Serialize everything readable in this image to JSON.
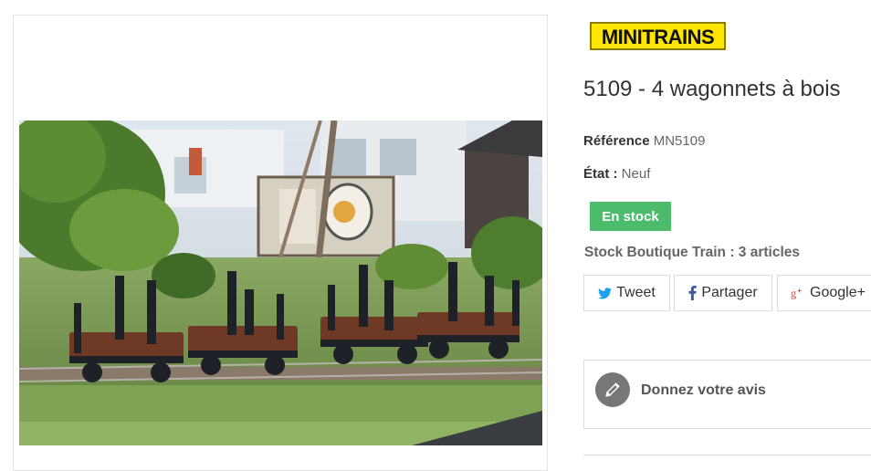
{
  "brand": {
    "logo_text": "MINITRAINS"
  },
  "product": {
    "title": "5109 - 4 wagonnets à bois",
    "reference_label": "Référence",
    "reference_value": "MN5109",
    "condition_label": "État :",
    "condition_value": "Neuf",
    "stock_badge": "En stock",
    "stock_boutique": "Stock Boutique Train : 3 articles",
    "image_alt": "4 wagonnets à bois sur voie de jardin miniature"
  },
  "share": {
    "tweet": "Tweet",
    "facebook": "Partager",
    "google": "Google+"
  },
  "review": {
    "label": "Donnez votre avis"
  },
  "colors": {
    "stock_green": "#4cbb6c",
    "twitter_blue": "#1da1f2",
    "facebook_blue": "#3b5998",
    "google_red": "#dd4b39",
    "logo_yellow": "#ffe600"
  },
  "icons": {
    "twitter": "twitter-bird-icon",
    "facebook": "facebook-f-icon",
    "google": "google-plus-icon",
    "review": "pencil-icon"
  }
}
